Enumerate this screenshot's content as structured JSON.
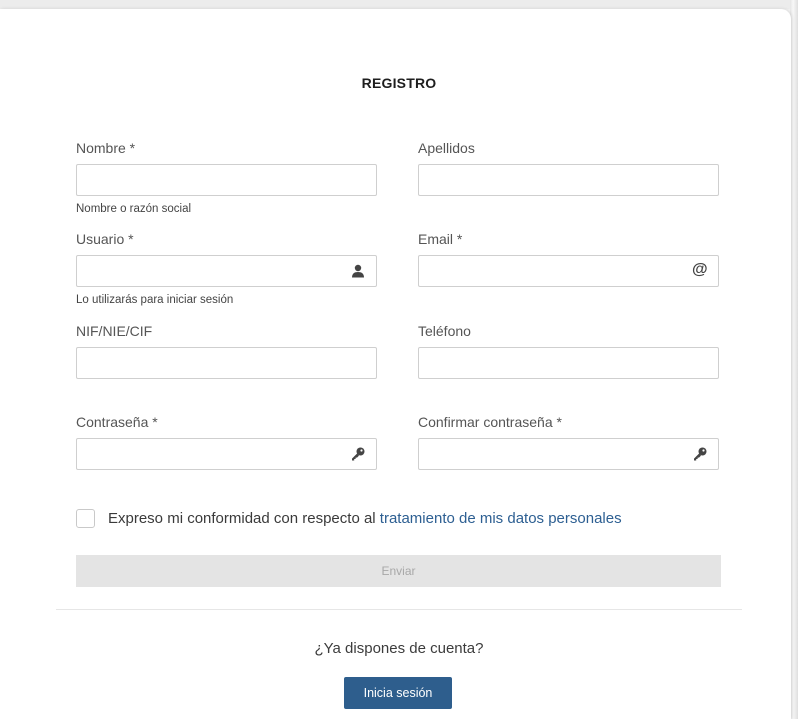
{
  "form": {
    "title": "REGISTRO",
    "fields": {
      "nombre": {
        "label": "Nombre *",
        "help": "Nombre o razón social",
        "value": ""
      },
      "apellidos": {
        "label": "Apellidos",
        "value": ""
      },
      "usuario": {
        "label": "Usuario *",
        "help": "Lo utilizarás para iniciar sesión",
        "value": "",
        "icon": "user-icon"
      },
      "email": {
        "label": "Email *",
        "value": "",
        "icon": "at-sign-icon",
        "icon_glyph": "@"
      },
      "nif": {
        "label": "NIF/NIE/CIF",
        "value": ""
      },
      "telefono": {
        "label": "Teléfono",
        "value": ""
      },
      "password": {
        "label": "Contraseña *",
        "value": "",
        "icon": "key-icon"
      },
      "confirm_password": {
        "label": "Confirmar contraseña *",
        "value": "",
        "icon": "key-icon"
      }
    },
    "consent": {
      "text": "Expreso mi conformidad con respecto al ",
      "link": "tratamiento de mis datos personales",
      "checked": false
    },
    "submit_label": "Enviar"
  },
  "footer": {
    "question": "¿Ya dispones de cuenta?",
    "login_label": "Inicia sesión"
  },
  "colors": {
    "primary": "#2e5e8d",
    "link": "#2d5f92",
    "disabled_button": "#e4e4e4",
    "input_border": "#cfcfcf"
  }
}
